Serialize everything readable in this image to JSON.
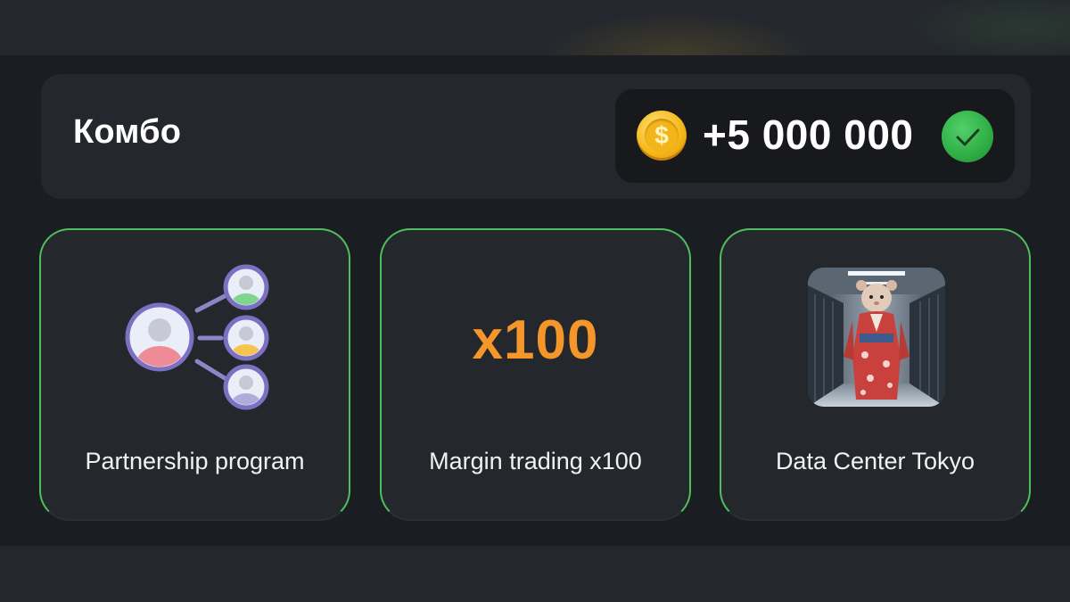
{
  "combo": {
    "title": "Комбо",
    "reward_amount": "+5 000 000",
    "coin_icon": "dollar-coin-icon",
    "status_icon": "check-icon"
  },
  "cards": [
    {
      "label": "Partnership program",
      "icon": "partnership-network-icon"
    },
    {
      "label": "Margin trading x100",
      "badge_text": "x100"
    },
    {
      "label": "Data Center Tokyo",
      "image": "hamster-in-kimono-server-room"
    }
  ],
  "colors": {
    "card_border_active": "#4fbf5c",
    "x100_orange": "#f4962a",
    "coin_gold": "#f6b91c",
    "check_green": "#2fae45"
  }
}
